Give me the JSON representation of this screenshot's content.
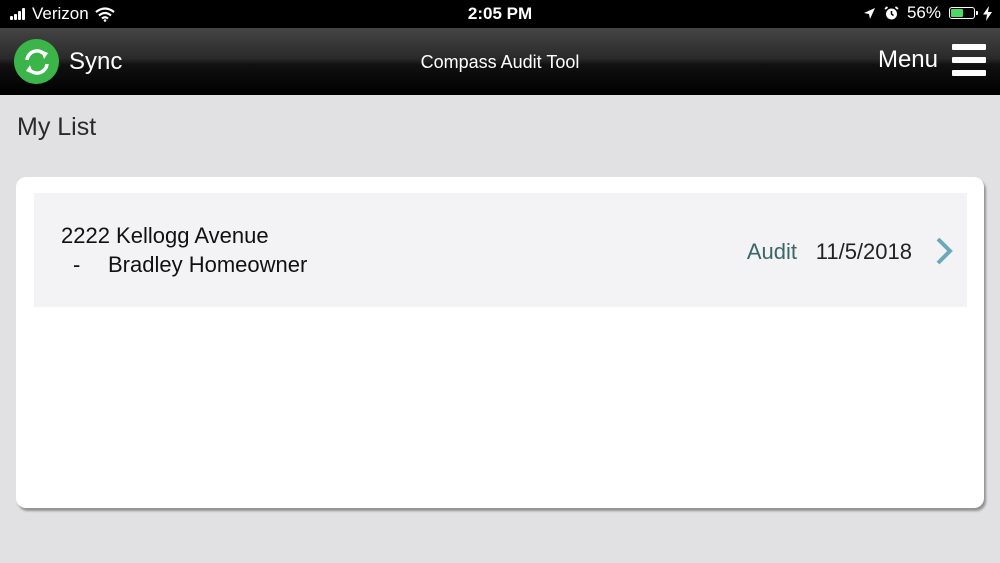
{
  "status_bar": {
    "carrier": "Verizon",
    "time": "2:05 PM",
    "battery_percent": "56%",
    "battery_level": 0.56,
    "icons": [
      "signal-icon",
      "wifi-icon",
      "location-icon",
      "alarm-icon",
      "battery-icon",
      "charging-icon"
    ]
  },
  "header": {
    "sync_label": "Sync",
    "title": "Compass Audit Tool",
    "menu_label": "Menu"
  },
  "page": {
    "title": "My List"
  },
  "list": {
    "items": [
      {
        "address": "2222 Kellogg Avenue",
        "dash": "-",
        "name": "Bradley Homeowner",
        "type": "Audit",
        "date": "11/5/2018"
      }
    ]
  },
  "colors": {
    "sync_green": "#3bb54a",
    "accent_teal": "#3a6668",
    "chevron": "#6aa9bb",
    "battery_green": "#4cd964"
  }
}
